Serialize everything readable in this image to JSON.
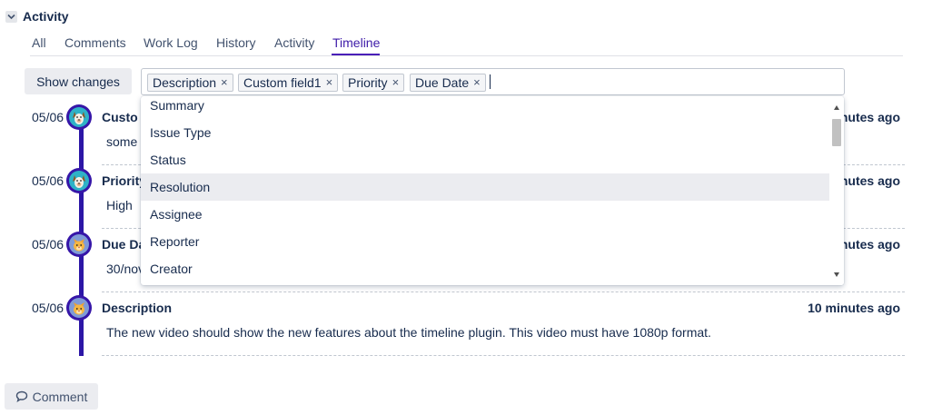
{
  "section": {
    "title": "Activity"
  },
  "tabs": [
    {
      "label": "All"
    },
    {
      "label": "Comments"
    },
    {
      "label": "Work Log"
    },
    {
      "label": "History"
    },
    {
      "label": "Activity"
    },
    {
      "label": "Timeline",
      "active": true
    }
  ],
  "filter": {
    "show_changes_label": "Show changes",
    "chips": [
      "Description",
      "Custom field1",
      "Priority",
      "Due Date"
    ],
    "remove_glyph": "×"
  },
  "dropdown_options": [
    "Summary",
    "Issue Type",
    "Status",
    "Resolution",
    "Assignee",
    "Reporter",
    "Creator"
  ],
  "dropdown_highlighted": "Resolution",
  "timeline": [
    {
      "date": "05/06",
      "title": "Custo",
      "value": "some",
      "time": "nutes ago",
      "avatar": "dog-icon"
    },
    {
      "date": "05/06",
      "title": "Priority",
      "value": "High",
      "time": "nutes ago",
      "avatar": "dog-icon"
    },
    {
      "date": "05/06",
      "title": "Due Da",
      "value": "30/nov",
      "time": "nutes ago",
      "avatar": "cat-icon"
    },
    {
      "date": "05/06",
      "title": "Description",
      "value": "The new video should show the new features about the timeline plugin. This video must have 1080p format.",
      "time": "10 minutes ago",
      "avatar": "cat-icon"
    }
  ],
  "comment_button_label": "Comment",
  "colors": {
    "accent": "#3d1aa8",
    "timeline": "#2c16a6",
    "dog_bg": "#2fb2c7",
    "cat_bg": "#7f9bd7"
  }
}
